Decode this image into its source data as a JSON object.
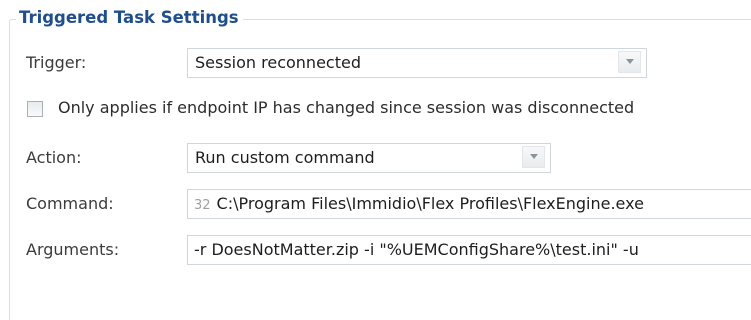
{
  "group": {
    "title": "Triggered Task Settings"
  },
  "trigger": {
    "label": "Trigger:",
    "selected": "Session reconnected"
  },
  "only_if_ip_changed": {
    "label": "Only applies if endpoint IP has changed since session was disconnected",
    "checked": false
  },
  "action": {
    "label": "Action:",
    "selected": "Run custom command"
  },
  "command": {
    "label": "Command:",
    "bitness": "32",
    "value": "C:\\Program Files\\Immidio\\Flex Profiles\\FlexEngine.exe"
  },
  "arguments": {
    "label": "Arguments:",
    "value": "-r DoesNotMatter.zip -i \"%UEMConfigShare%\\test.ini\" -u"
  }
}
